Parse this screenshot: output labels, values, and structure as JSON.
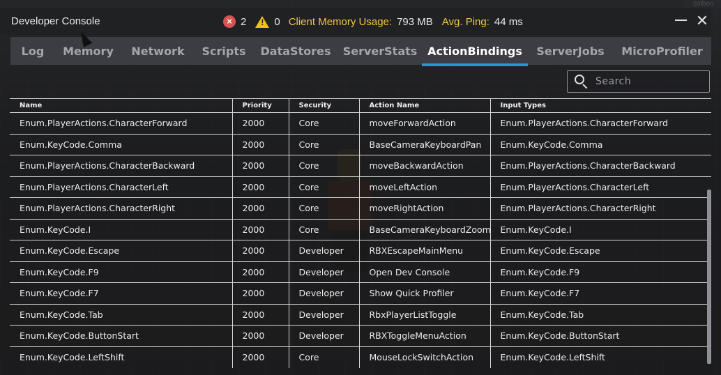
{
  "window": {
    "title": "Developer Console",
    "corner_label": "colben",
    "minimize_icon": "minimize-icon",
    "close_icon": "close-icon",
    "close_glyph": "✕"
  },
  "status": {
    "error_count": "2",
    "warning_count": "0",
    "memory_label": "Client Memory Usage:",
    "memory_value": "793 MB",
    "ping_label": "Avg. Ping:",
    "ping_value": "44 ms",
    "error_icon": "error-icon",
    "warning_icon": "warning-icon",
    "error_glyph": "×",
    "accent_color": "#f5c542",
    "error_color": "#d9534f",
    "warning_color": "#f4c20d"
  },
  "tabs": [
    {
      "label": "Log"
    },
    {
      "label": "Memory"
    },
    {
      "label": "Network"
    },
    {
      "label": "Scripts"
    },
    {
      "label": "DataStores"
    },
    {
      "label": "ServerStats"
    },
    {
      "label": "ActionBindings"
    },
    {
      "label": "ServerJobs"
    },
    {
      "label": "MicroProfiler"
    }
  ],
  "active_tab": "ActionBindings",
  "active_tab_color": "#1e98d9",
  "search": {
    "placeholder": "Search",
    "value": "",
    "icon": "search-icon"
  },
  "table": {
    "headers": {
      "name": "Name",
      "priority": "Priority",
      "security": "Security",
      "action_name": "Action Name",
      "input_types": "Input Types"
    },
    "rows": [
      {
        "name": "Enum.PlayerActions.CharacterForward",
        "priority": "2000",
        "security": "Core",
        "action": "moveForwardAction",
        "input": "Enum.PlayerActions.CharacterForward"
      },
      {
        "name": "Enum.KeyCode.Comma",
        "priority": "2000",
        "security": "Core",
        "action": "BaseCameraKeyboardPan",
        "input": "Enum.KeyCode.Comma"
      },
      {
        "name": "Enum.PlayerActions.CharacterBackward",
        "priority": "2000",
        "security": "Core",
        "action": "moveBackwardAction",
        "input": "Enum.PlayerActions.CharacterBackward"
      },
      {
        "name": "Enum.PlayerActions.CharacterLeft",
        "priority": "2000",
        "security": "Core",
        "action": "moveLeftAction",
        "input": "Enum.PlayerActions.CharacterLeft"
      },
      {
        "name": "Enum.PlayerActions.CharacterRight",
        "priority": "2000",
        "security": "Core",
        "action": "moveRightAction",
        "input": "Enum.PlayerActions.CharacterRight"
      },
      {
        "name": "Enum.KeyCode.I",
        "priority": "2000",
        "security": "Core",
        "action": "BaseCameraKeyboardZoom",
        "input": "Enum.KeyCode.I"
      },
      {
        "name": "Enum.KeyCode.Escape",
        "priority": "2000",
        "security": "Developer",
        "action": "RBXEscapeMainMenu",
        "input": "Enum.KeyCode.Escape"
      },
      {
        "name": "Enum.KeyCode.F9",
        "priority": "2000",
        "security": "Developer",
        "action": "Open Dev Console",
        "input": "Enum.KeyCode.F9"
      },
      {
        "name": "Enum.KeyCode.F7",
        "priority": "2000",
        "security": "Developer",
        "action": "Show Quick Profiler",
        "input": "Enum.KeyCode.F7"
      },
      {
        "name": "Enum.KeyCode.Tab",
        "priority": "2000",
        "security": "Developer",
        "action": "RbxPlayerListToggle",
        "input": "Enum.KeyCode.Tab"
      },
      {
        "name": "Enum.KeyCode.ButtonStart",
        "priority": "2000",
        "security": "Developer",
        "action": "RBXToggleMenuAction",
        "input": "Enum.KeyCode.ButtonStart"
      },
      {
        "name": "Enum.KeyCode.LeftShift",
        "priority": "2000",
        "security": "Core",
        "action": "MouseLockSwitchAction",
        "input": "Enum.KeyCode.LeftShift"
      }
    ]
  }
}
